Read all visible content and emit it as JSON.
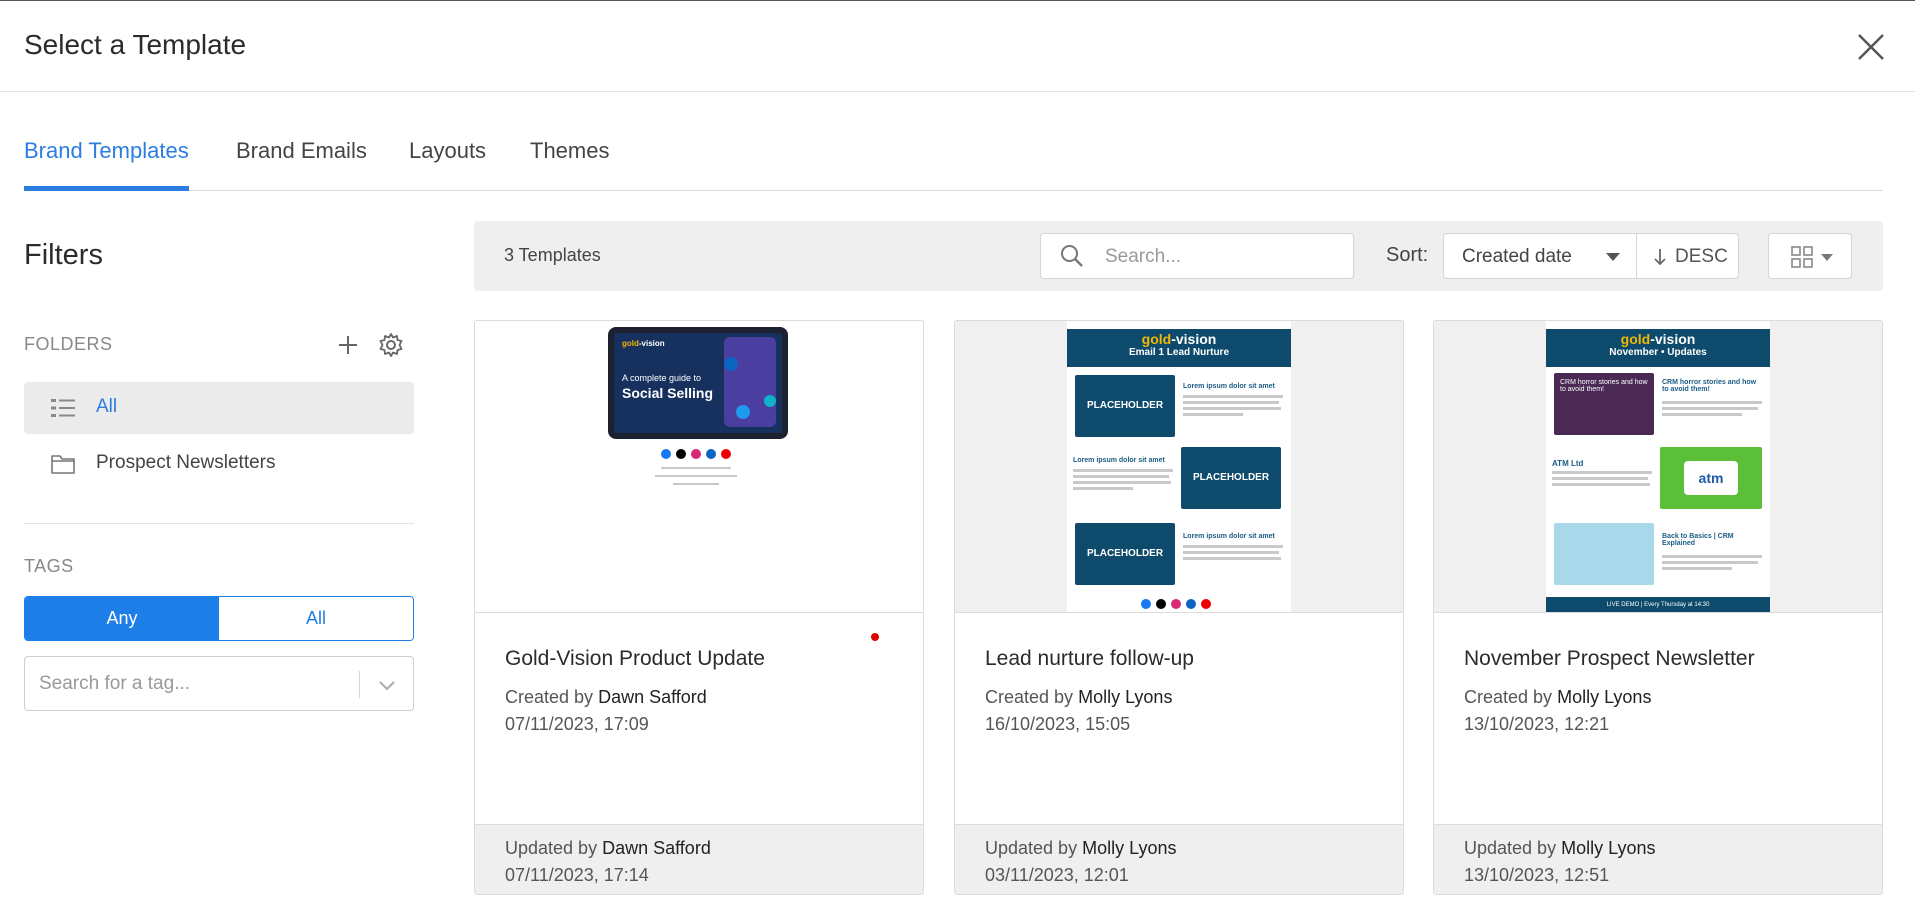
{
  "dialog": {
    "title": "Select a Template"
  },
  "tabs": [
    {
      "label": "Brand Templates",
      "active": true
    },
    {
      "label": "Brand Emails",
      "active": false
    },
    {
      "label": "Layouts",
      "active": false
    },
    {
      "label": "Themes",
      "active": false
    }
  ],
  "filters": {
    "title": "Filters",
    "folders_label": "FOLDERS",
    "folders": [
      {
        "label": "All",
        "selected": true,
        "icon": "list-icon"
      },
      {
        "label": "Prospect Newsletters",
        "selected": false,
        "icon": "folder-icon"
      }
    ],
    "tags_label": "TAGS",
    "tag_match": {
      "any_label": "Any",
      "all_label": "All",
      "selected": "Any"
    },
    "tag_search_placeholder": "Search for a tag..."
  },
  "toolbar": {
    "count_text": "3 Templates",
    "search_placeholder": "Search...",
    "sort_label": "Sort:",
    "sort_value": "Created date",
    "sort_direction": "DESC",
    "view": "grid-icon"
  },
  "thumbnails": {
    "brand": "gold-vision",
    "brand_prefix": "gold",
    "brand_suffix": "-vision",
    "social_title_line1": "A complete guide to",
    "social_title_line2": "Social Selling",
    "lead_subtitle": "Email 1 Lead Nurture",
    "newsletter_subtitle": "November • Updates",
    "placeholder_label": "PLACEHOLDER",
    "lorem_heading": "Lorem ipsum dolor sit amet",
    "crm_heading": "CRM horror stories and how to avoid them!",
    "atm_heading": "ATM Ltd",
    "atm_logo": "atm",
    "back_heading": "Back to Basics | CRM Explained",
    "crm_image_text": "CRM horror stories and how to avoid them!",
    "live_demo": "LIVE DEMO | Every Thursday at 14:30"
  },
  "templates": [
    {
      "name": "Gold-Vision Product Update",
      "created_prefix": "Created by",
      "created_by": "Dawn Safford",
      "created_date": "07/11/2023, 17:09",
      "updated_prefix": "Updated by",
      "updated_by": "Dawn Safford",
      "updated_date": "07/11/2023, 17:14"
    },
    {
      "name": "Lead nurture follow-up",
      "created_prefix": "Created by",
      "created_by": "Molly Lyons",
      "created_date": "16/10/2023, 15:05",
      "updated_prefix": "Updated by",
      "updated_by": "Molly Lyons",
      "updated_date": "03/11/2023, 12:01"
    },
    {
      "name": "November Prospect Newsletter",
      "created_prefix": "Created by",
      "created_by": "Molly Lyons",
      "created_date": "13/10/2023, 12:21",
      "updated_prefix": "Updated by",
      "updated_by": "Molly Lyons",
      "updated_date": "13/10/2023, 12:51"
    }
  ],
  "colors": {
    "accent": "#2b7de0",
    "toggle_blue": "#1e7ee8",
    "brand_navy": "#0e4a6b",
    "brand_gold": "#f2b705",
    "indicator_red": "#e00000"
  }
}
